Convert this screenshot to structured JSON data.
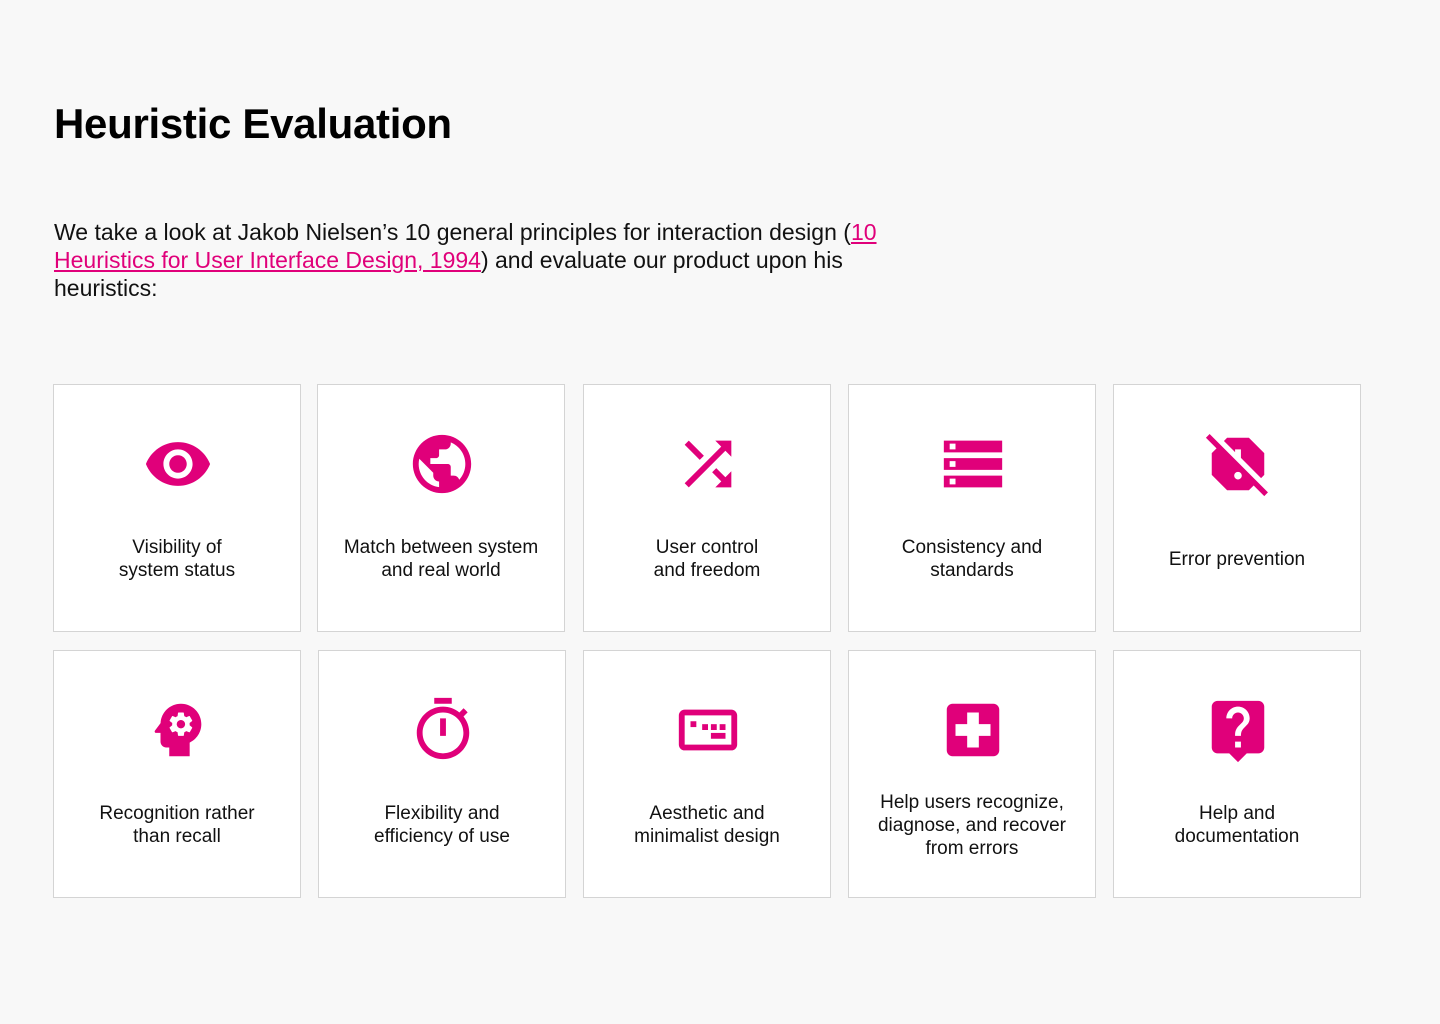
{
  "page": {
    "title": "Heuristic Evaluation",
    "intro_before": "We take a look at Jakob Nielsen’s 10 general principles for interaction design (",
    "intro_link": "10 Heuristics for User Interface Design, 1994",
    "intro_after": ") and evaluate our product upon his heuristics:"
  },
  "colors": {
    "accent": "#e0007a",
    "background": "#f8f8f8",
    "card": "#ffffff",
    "card_border": "#d4d4d4",
    "text": "#111111"
  },
  "heuristics": [
    {
      "label": "Visibility of\nsystem status",
      "icon": "eye-icon"
    },
    {
      "label": "Match between system\nand real world",
      "icon": "globe-icon"
    },
    {
      "label": "User control\nand freedom",
      "icon": "shuffle-icon"
    },
    {
      "label": "Consistency and\nstandards",
      "icon": "storage-icon"
    },
    {
      "label": "Error prevention",
      "icon": "report-off-icon"
    },
    {
      "label": "Recognition rather\nthan recall",
      "icon": "psychology-icon"
    },
    {
      "label": "Flexibility and\nefficiency of use",
      "icon": "timer-icon"
    },
    {
      "label": "Aesthetic and\nminimalist design",
      "icon": "dialpad-icon"
    },
    {
      "label": "Help users recognize,\ndiagnose, and recover\nfrom errors",
      "icon": "medical-cross-icon"
    },
    {
      "label": "Help and\ndocumentation",
      "icon": "help-bubble-icon"
    }
  ]
}
